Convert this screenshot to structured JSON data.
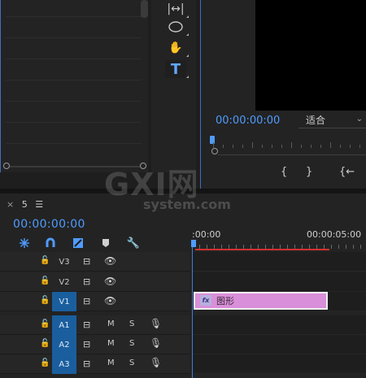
{
  "program_monitor": {
    "timecode": "00:00:00:00",
    "fit_label": "适合",
    "buttons": [
      "{",
      "}",
      "{←"
    ]
  },
  "timeline": {
    "sequence_tab": "5",
    "timecode": "00:00:00:00",
    "ruler_start": ":00:00",
    "ruler_end": "00:00:05:00",
    "tracks": [
      {
        "name": "V3",
        "type": "video",
        "targeted": false
      },
      {
        "name": "V2",
        "type": "video",
        "targeted": false
      },
      {
        "name": "V1",
        "type": "video",
        "targeted": true
      },
      {
        "name": "A1",
        "type": "audio",
        "targeted": true
      },
      {
        "name": "A2",
        "type": "audio",
        "targeted": true
      },
      {
        "name": "A3",
        "type": "audio",
        "targeted": true
      }
    ],
    "audio_mute_label": "M",
    "audio_solo_label": "S",
    "clip": {
      "name": "图形",
      "fx": "fx",
      "track": "V1",
      "color": "#d98fd9"
    }
  },
  "watermark": {
    "main": "GXI网",
    "sub": "system.com"
  },
  "colors": {
    "accent": "#4f9bff",
    "track_target": "#1a5e9e",
    "work_area": "#d2302f"
  }
}
